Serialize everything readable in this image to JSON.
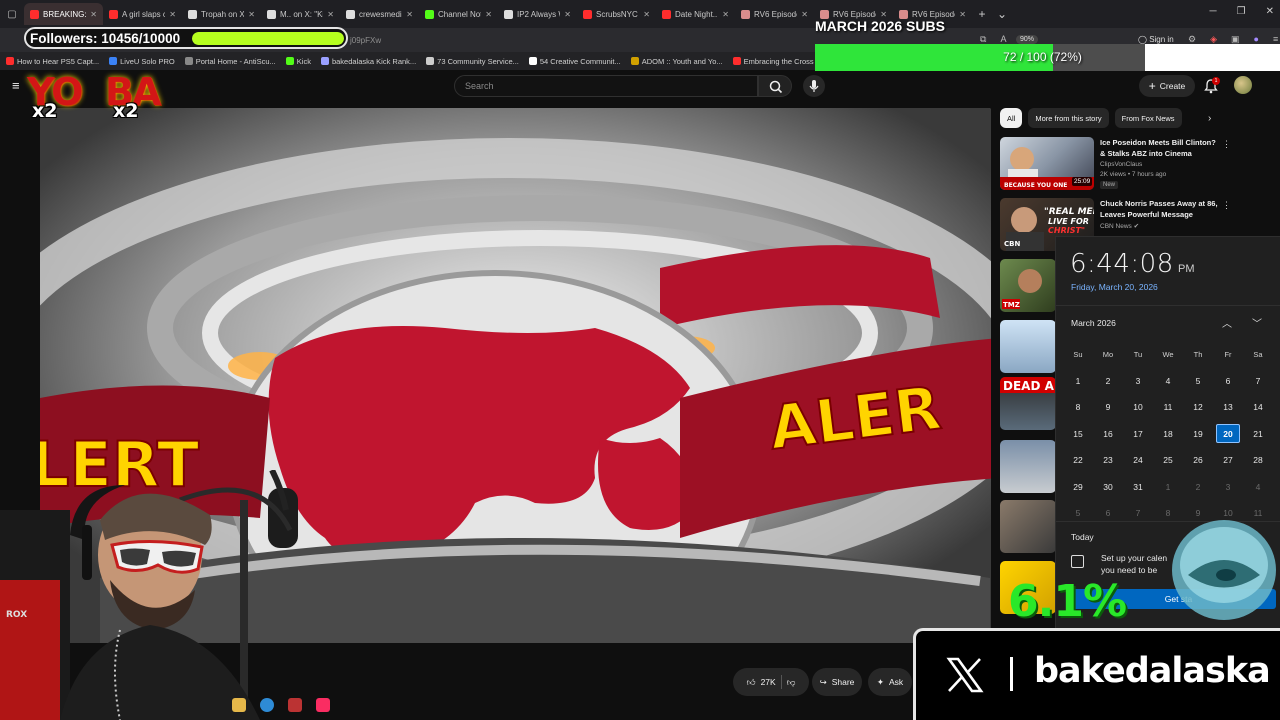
{
  "browser": {
    "tabs": [
      {
        "label": "BREAKING: Chu",
        "color": "#ff2d2d",
        "active": true
      },
      {
        "label": "A girl slaps clavic",
        "color": "#ff2d2d"
      },
      {
        "label": "Tropah on X: \"",
        "color": "#dddddd"
      },
      {
        "label": "M.. on X: \"Kick",
        "color": "#dddddd"
      },
      {
        "label": "crewesmedia on",
        "color": "#dddddd"
      },
      {
        "label": "Channel Not Fo",
        "color": "#53fc18"
      },
      {
        "label": "IP2 Always Wins",
        "color": "#dddddd"
      },
      {
        "label": "ScrubsNYC Gets",
        "color": "#ff2d2d"
      },
      {
        "label": "Date Night.. GO",
        "color": "#ff2d2d"
      },
      {
        "label": "RV6 Episode 26",
        "color": "#d98c8c"
      },
      {
        "label": "RV6 Episode 27",
        "color": "#d98c8c"
      },
      {
        "label": "RV6 Episode 28",
        "color": "#d98c8c"
      }
    ],
    "url_fragment": "j09pFXw",
    "zoom": "90%",
    "sign_in": "Sign in",
    "bookmarks": [
      {
        "label": "How to Hear PS5 Capt...",
        "color": "#ff2d2d"
      },
      {
        "label": "LiveU Solo PRO",
        "color": "#3b82f6"
      },
      {
        "label": "Portal Home - AntiScu...",
        "color": "#888888"
      },
      {
        "label": "Kick",
        "color": "#53fc18"
      },
      {
        "label": "bakedalaska Kick Rank...",
        "color": "#9aa0ff"
      },
      {
        "label": "73 Community Service...",
        "color": "#cccccc"
      },
      {
        "label": "54 Creative Communit...",
        "color": "#ffffff"
      },
      {
        "label": "ADOM :: Youth and Yo...",
        "color": "#d0a000"
      },
      {
        "label": "Embracing the Cross a...",
        "color": "#ff2d2d"
      }
    ]
  },
  "youtube": {
    "search_placeholder": "Search",
    "create_label": "Create",
    "notif_count": "1",
    "chips": [
      "All",
      "More from this story",
      "From Fox News"
    ],
    "recommendations": [
      {
        "title": "Ice Poseidon Meets Bill Clinton? & Stalks ABZ into Cinema",
        "channel": "ClipsVonClaus",
        "meta": "2K views • 7 hours ago",
        "badge": "New",
        "duration": "25:09"
      },
      {
        "title": "Chuck Norris Passes Away at 86, Leaves Powerful Message",
        "channel": "CBN News ✔",
        "meta": "",
        "badge": "",
        "duration": ""
      }
    ],
    "actions": {
      "likes": "27K",
      "share": "Share",
      "ask": "Ask"
    }
  },
  "video": {
    "graphic_text_left": "LERT",
    "graphic_text_right": "ALER"
  },
  "clock": {
    "time": "6:44:08",
    "ampm": "PM",
    "date": "Friday, March 20, 2026",
    "month": "March 2026",
    "weekdays": [
      "Su",
      "Mo",
      "Tu",
      "We",
      "Th",
      "Fr",
      "Sa"
    ],
    "weeks": [
      [
        "1",
        "2",
        "3",
        "4",
        "5",
        "6",
        "7"
      ],
      [
        "8",
        "9",
        "10",
        "11",
        "12",
        "13",
        "14"
      ],
      [
        "15",
        "16",
        "17",
        "18",
        "19",
        "20",
        "21"
      ],
      [
        "22",
        "23",
        "24",
        "25",
        "26",
        "27",
        "28"
      ],
      [
        "29",
        "30",
        "31",
        "1",
        "2",
        "3",
        "4"
      ],
      [
        "5",
        "6",
        "7",
        "8",
        "9",
        "10",
        "11"
      ]
    ],
    "selected_day": "20",
    "today_label": "Today",
    "event_line1": "Set up your calen",
    "event_line2": "you need to be",
    "get_started": "Get sta"
  },
  "overlays": {
    "followers_label": "Followers: 10456/10000",
    "followers_progress": 1.0,
    "subs_title": "MARCH 2026 SUBS",
    "subs_text": "72 / 100 (72%)",
    "subs_progress": 0.72,
    "yo_text": "YO",
    "ba_text": "BA",
    "multiplier_a": "x2",
    "multiplier_b": "x2",
    "percent_text": "6.1%",
    "x_handle": "bakedalaska"
  },
  "colors": {
    "accent_blue": "#0067c0",
    "followers_bar": "#b6ff1e",
    "subs_bar": "#2fe53a",
    "alert_red": "#c8102e",
    "alert_yellow": "#ffd400"
  }
}
